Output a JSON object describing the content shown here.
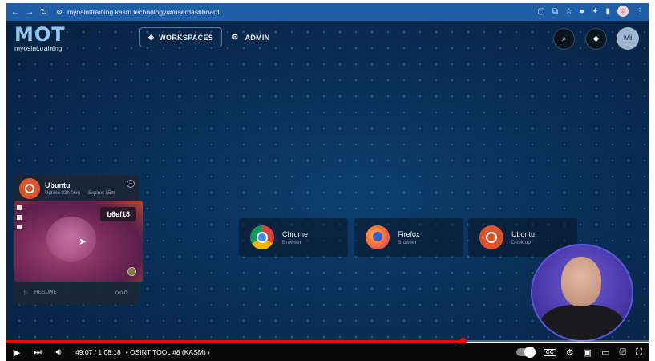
{
  "browser": {
    "url": "myosinttraining.kasm.technology/#/userdashboard",
    "profile_initial": "☺"
  },
  "app": {
    "logo_mark": "MOT",
    "logo_sub": "myosint.training",
    "nav": {
      "workspaces": "WORKSPACES",
      "admin": "ADMIN"
    },
    "avatar": "Mi"
  },
  "session": {
    "title": "Ubuntu",
    "uptime": "Uptime 03h 06m",
    "expires": "Expires 55m",
    "id_tag": "b6ef18",
    "resume": "RESUME",
    "more": "ooo"
  },
  "workspaces": [
    {
      "name": "Chrome",
      "kind": "Browser",
      "icon": "chrome-icon"
    },
    {
      "name": "Firefox",
      "kind": "Browser",
      "icon": "firefox-icon"
    },
    {
      "name": "Ubuntu",
      "kind": "Desktop",
      "icon": "ubuntu-icon"
    }
  ],
  "player": {
    "time": "49:07 / 1:08:18",
    "chapter": "• OSINT TOOL #8 (KASM) ›",
    "progress": 0.71
  },
  "colors": {
    "accent": "#ff0000",
    "bg": "#0a2f57",
    "ubuntu": "#e0542a"
  }
}
